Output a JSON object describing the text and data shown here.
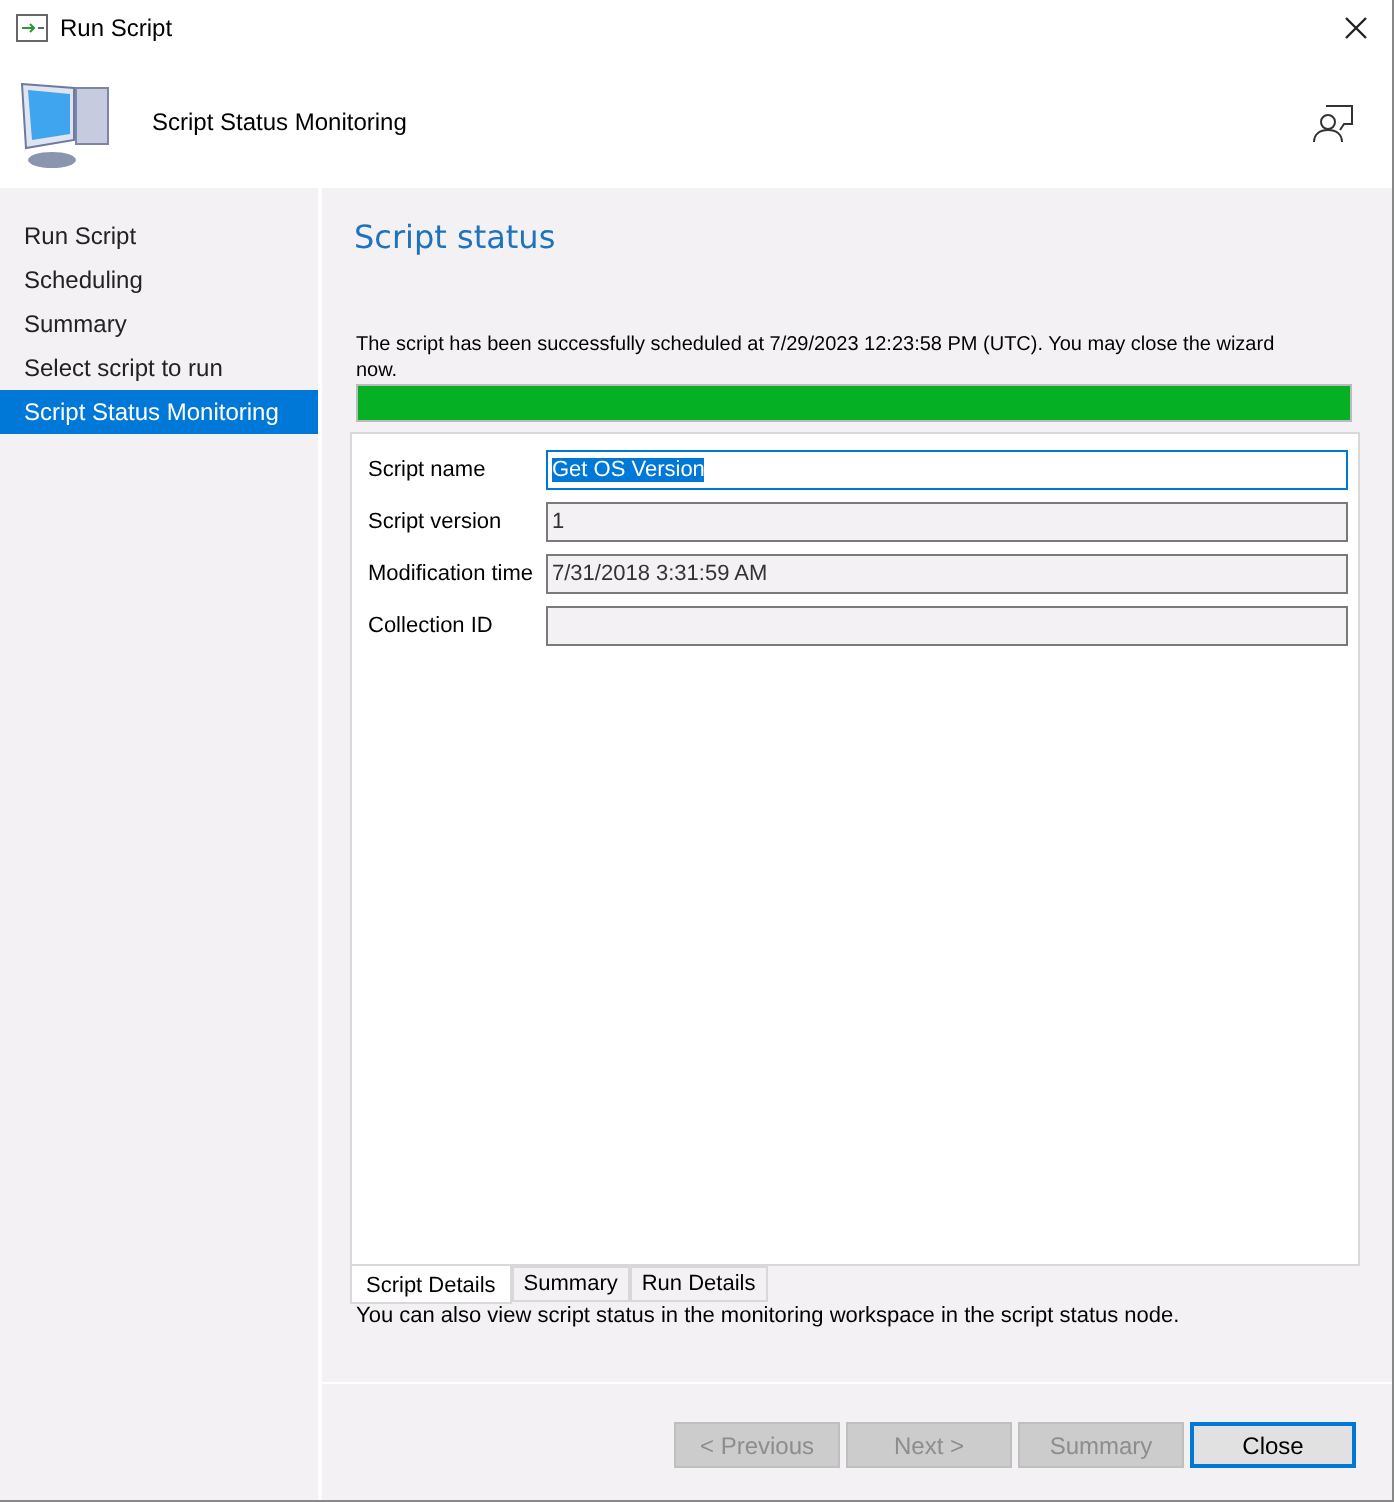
{
  "window": {
    "title": "Run Script"
  },
  "header": {
    "title": "Script Status Monitoring"
  },
  "steps": [
    {
      "label": "Run Script",
      "selected": false
    },
    {
      "label": "Scheduling",
      "selected": false
    },
    {
      "label": "Summary",
      "selected": false
    },
    {
      "label": "Select script to run",
      "selected": false
    },
    {
      "label": "Script Status Monitoring",
      "selected": true
    }
  ],
  "page_title": "Script status",
  "message": "The script has been successfully scheduled at 7/29/2023 12:23:58 PM (UTC). You may close the wizard now.",
  "progress": {
    "level": 1
  },
  "fields": [
    {
      "label": "Script name",
      "value": "Get OS Version",
      "focused": true
    },
    {
      "label": "Script version",
      "value": "1",
      "focused": false
    },
    {
      "label": "Modification time",
      "value": "7/31/2018 3:31:59 AM",
      "focused": false
    },
    {
      "label": "Collection ID",
      "focused": false
    }
  ],
  "tabs": [
    {
      "label": "Script Details",
      "selected": true
    },
    {
      "label": "Summary",
      "selected": false
    },
    {
      "label": "Run Details",
      "selected": false
    }
  ],
  "note": "You can also view script status in the monitoring workspace in the script status node.",
  "buttons": [
    {
      "label": "< Previous",
      "disabled": true
    },
    {
      "label": "Next >",
      "disabled": true
    },
    {
      "label": "Summary",
      "disabled": true
    },
    {
      "label": "Close",
      "disabled": false
    }
  ]
}
